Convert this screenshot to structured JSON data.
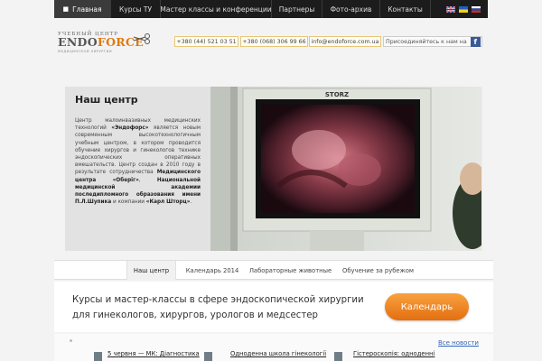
{
  "nav": {
    "items": [
      {
        "label": "Главная",
        "active": true,
        "icon": "home-icon"
      },
      {
        "label": "Курсы ТУ"
      },
      {
        "label": "Мастер классы и конференции"
      },
      {
        "label": "Партнеры"
      },
      {
        "label": "Фото-архив"
      },
      {
        "label": "Контакты"
      }
    ],
    "languages": [
      "en",
      "uk",
      "ru"
    ]
  },
  "logo": {
    "top": "УЧЕБНЫЙ ЦЕНТР",
    "main_a": "ENDO",
    "main_b": "FORCE",
    "sub": "МЕДИЦИНСКОЙ ХИРУРГИИ"
  },
  "contacts": {
    "phone1": "+380 (44) 521 03 51",
    "phone2": "+380 (068) 306 99 66",
    "email": "info@endoforce.com.ua",
    "join": "Присоединяйтесь к нам на"
  },
  "about": {
    "title": "Наш центр",
    "text_1": "Центр малоинвазивных медицинских технологий ",
    "brand": "«Эндофорс»",
    "text_2": " является новым современным высокотехнологичным учебным центром, в котором проводится обучение хирургов и гинекологов технике эндоскопических оперативных вмешательств. Центр создан в 2010 году в результате сотрудничества ",
    "partner_1": "Медицинского центра «Оберіг»",
    "text_3": ", ",
    "partner_2": "Национальной медицинской академии последипломного образования имени П.Л.Шупика",
    "text_4": " и компании ",
    "partner_3": "«Карл Шторц»",
    "text_5": "."
  },
  "photo": {
    "monitor_brand": "STORZ"
  },
  "tabs": [
    {
      "label": "Наш центр",
      "active": true
    },
    {
      "label": "Календарь 2014"
    },
    {
      "label": "Лабораторные животные"
    },
    {
      "label": "Обучение за рубежом"
    }
  ],
  "banner": {
    "line1": "Курсы и мастер-классы в сфере эндоскопической хирургии",
    "line2": "для гинекологов, хирургов, урологов и медсестер",
    "button": "Календарь"
  },
  "news": {
    "all_news": "Все новости",
    "items": [
      "5 червня — МК: Діагностика",
      "Одноденна школа гінекології",
      "Гістероскопія: одноденні"
    ]
  },
  "colors": {
    "accent": "#e8801a",
    "nav_bg": "#1c1c1c",
    "link": "#3366bb"
  }
}
